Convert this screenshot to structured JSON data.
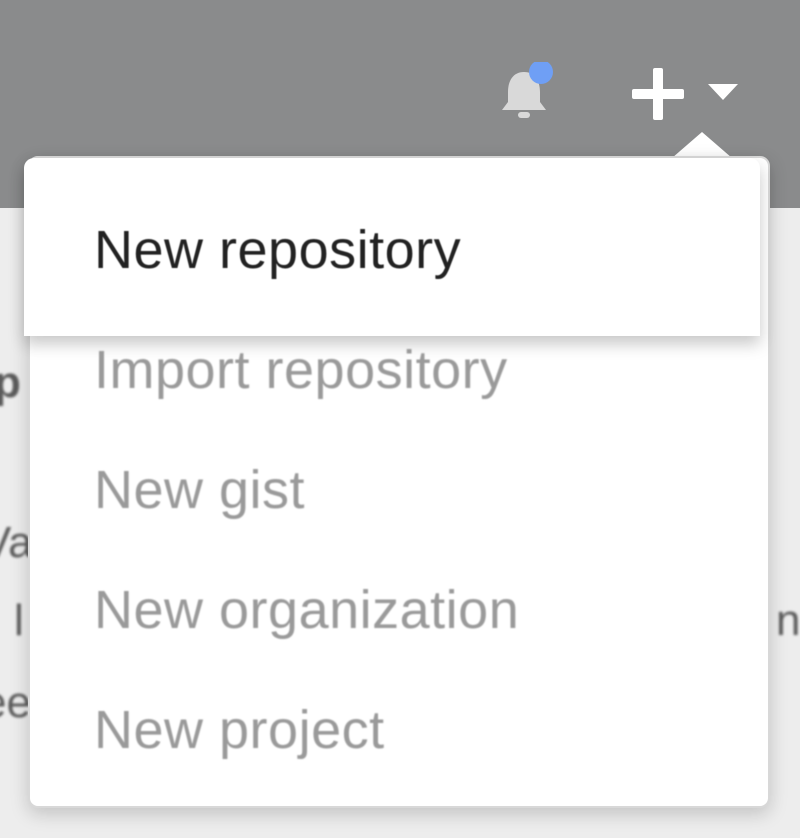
{
  "header": {
    "notifications_icon": "bell-icon",
    "notification_dot_color": "#6f9ff5",
    "create_icon": "plus-icon",
    "create_dropdown_icon": "caret-down-icon"
  },
  "menu": {
    "items": [
      {
        "label": "New repository",
        "state": "highlighted"
      },
      {
        "label": "Import repository",
        "state": "normal"
      },
      {
        "label": "New gist",
        "state": "normal"
      },
      {
        "label": "New organization",
        "state": "normal"
      },
      {
        "label": "New project",
        "state": "normal"
      }
    ]
  },
  "background": {
    "fragments": [
      "p",
      "Va",
      "l",
      "ne",
      "ee"
    ]
  },
  "colors": {
    "header_bg": "#8a8b8c",
    "menu_bg": "#ffffff",
    "text_active": "#222222",
    "text_muted": "#9a9a9a"
  }
}
